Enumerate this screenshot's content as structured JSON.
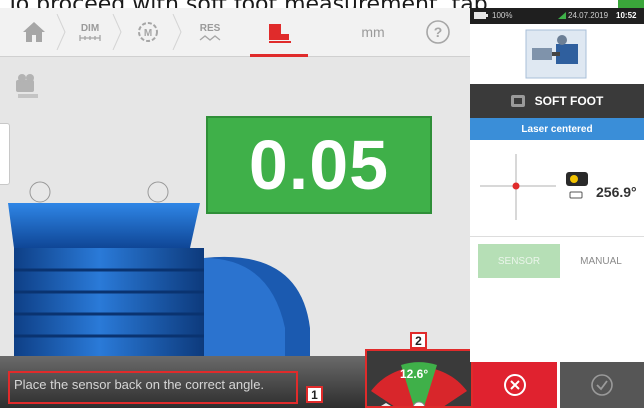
{
  "instruction": {
    "text": "To proceed with soft foot measurement, tap"
  },
  "toolbar": {
    "items": [
      {
        "name": "home",
        "label": ""
      },
      {
        "name": "dimensions",
        "label": "DIM"
      },
      {
        "name": "machines",
        "label": "M"
      },
      {
        "name": "results",
        "label": "RES"
      },
      {
        "name": "soft-foot",
        "label": ""
      },
      {
        "name": "units",
        "label": "mm"
      },
      {
        "name": "help",
        "label": "?"
      }
    ],
    "active": "soft-foot"
  },
  "reading": {
    "value": "0.05",
    "color": "#3fb049"
  },
  "status": {
    "message": "Place the sensor back on the correct angle.",
    "callout_1": "1",
    "callout_2": "2"
  },
  "gauge": {
    "angle": "12.6°"
  },
  "panel": {
    "status_bar": {
      "battery": "100%",
      "date": "24.07.2019",
      "time": "10:52"
    },
    "title": "SOFT FOOT",
    "laser_status": "Laser centered",
    "sensor_angle": "256.9°",
    "modes": {
      "sensor": "SENSOR",
      "manual": "MANUAL"
    }
  },
  "colors": {
    "accent_red": "#e02b2b",
    "ok_green": "#3fb049",
    "laser_blue": "#3a8ed8",
    "motor_blue": "#1d5fb0"
  }
}
